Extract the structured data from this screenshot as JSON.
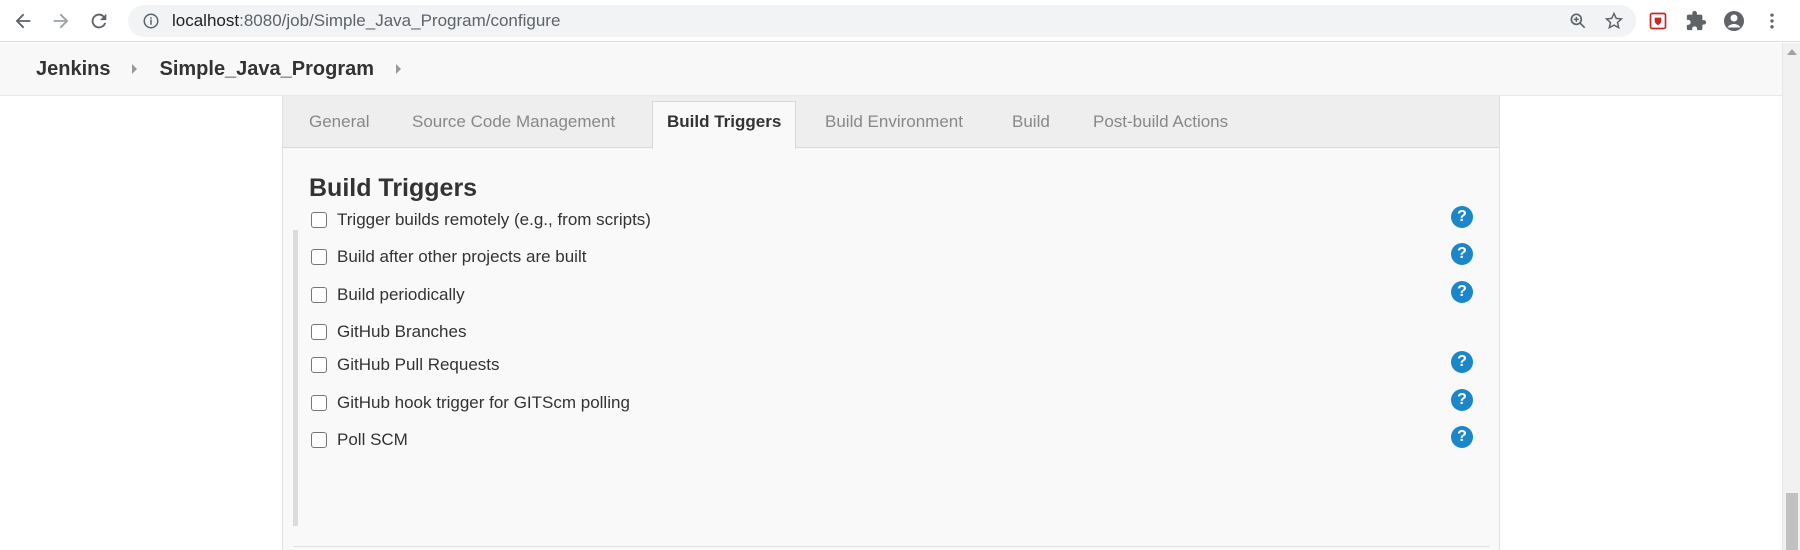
{
  "browser": {
    "url_host": "localhost",
    "url_path": ":8080/job/Simple_Java_Program/configure",
    "icons": [
      "back-icon",
      "forward-icon",
      "reload-icon",
      "info-icon",
      "zoom-icon",
      "star-icon",
      "extension-shield-icon",
      "puzzle-icon",
      "account-icon",
      "menu-dots-icon"
    ]
  },
  "breadcrumb": {
    "items": [
      "Jenkins",
      "Simple_Java_Program"
    ]
  },
  "tabs": [
    {
      "label": "General"
    },
    {
      "label": "Source Code Management"
    },
    {
      "label": "Build Triggers"
    },
    {
      "label": "Build Environment"
    },
    {
      "label": "Build"
    },
    {
      "label": "Post-build Actions"
    }
  ],
  "active_tab": "Build Triggers",
  "section": {
    "title": "Build Triggers"
  },
  "triggers": [
    {
      "label": "Trigger builds remotely (e.g., from scripts)",
      "checked": false,
      "help": "?"
    },
    {
      "label": "Build after other projects are built",
      "checked": false,
      "help": "?"
    },
    {
      "label": "Build periodically",
      "checked": false,
      "help": "?"
    },
    {
      "label": "GitHub Branches",
      "checked": false
    },
    {
      "label": "GitHub Pull Requests",
      "checked": false,
      "help": "?"
    },
    {
      "label": "GitHub hook trigger for GITScm polling",
      "checked": false,
      "help": "?"
    },
    {
      "label": "Poll SCM",
      "checked": false,
      "help": "?"
    }
  ],
  "colors": {
    "help_icon": "#1b87c9",
    "tab_bar": "#eeeeee",
    "panel": "#f9f9f9"
  }
}
